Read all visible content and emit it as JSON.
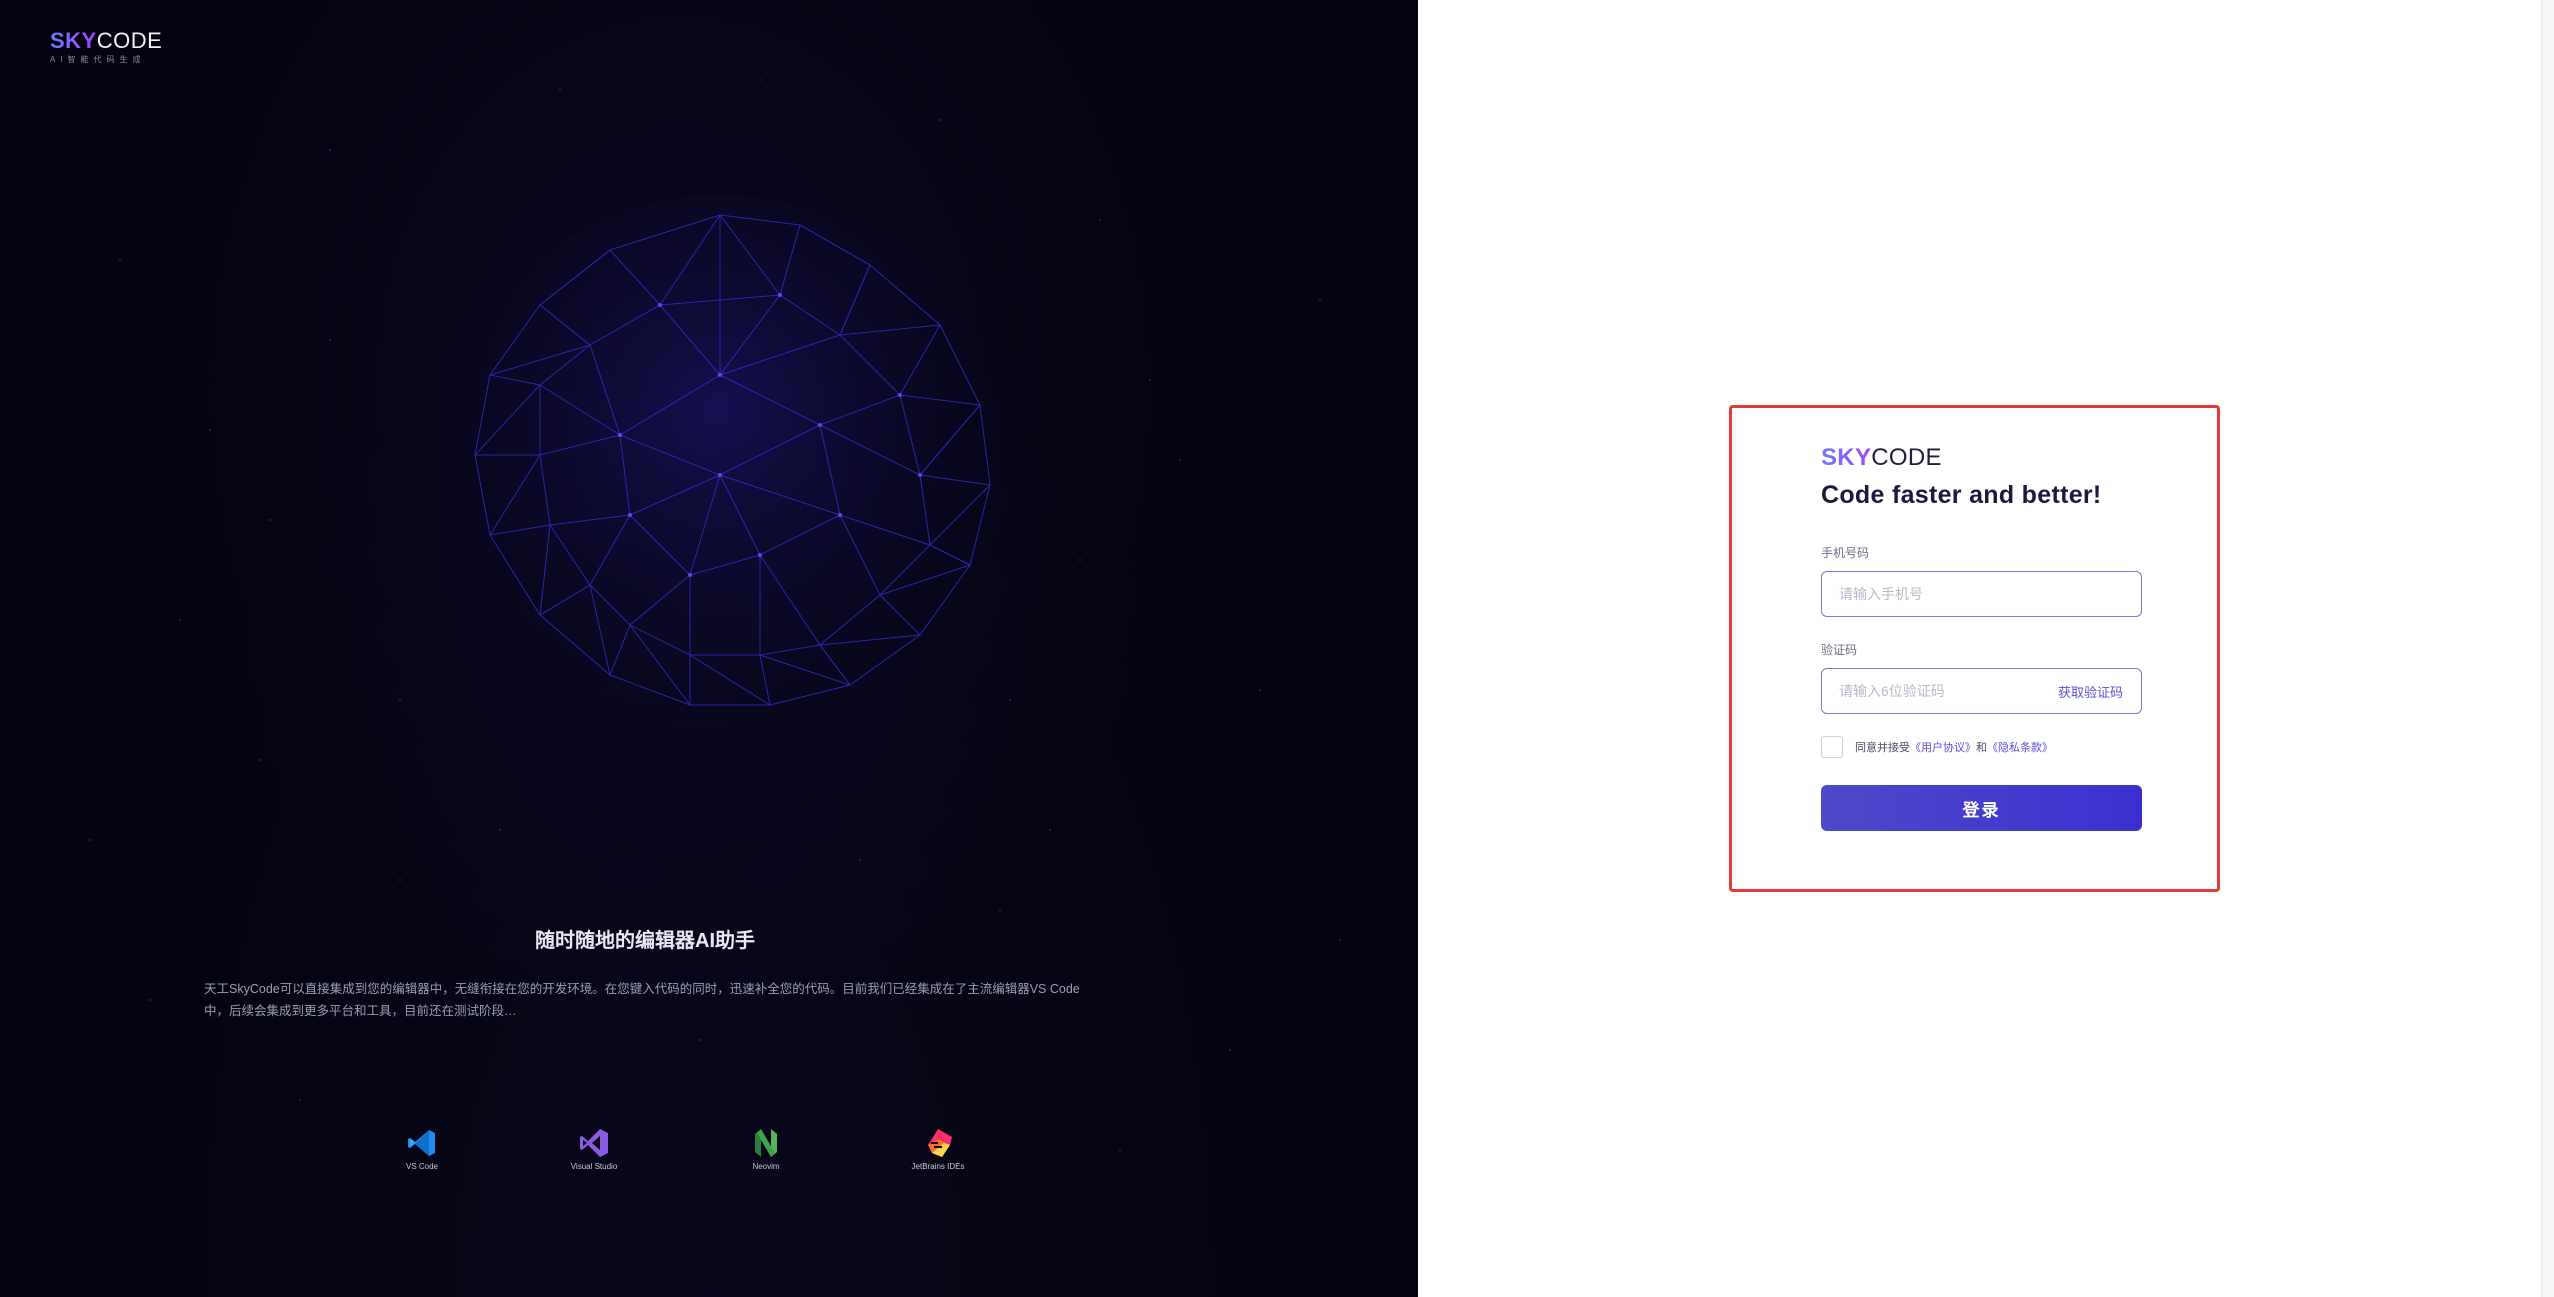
{
  "brand": {
    "logo_sky": "SKY",
    "logo_code": "CODE",
    "tagline": "AI智能代码生成"
  },
  "hero": {
    "title": "随时随地的编辑器AI助手",
    "description": "天工SkyCode可以直接集成到您的编辑器中，无缝衔接在您的开发环境。在您键入代码的同时，迅速补全您的代码。目前我们已经集成在了主流编辑器VS Code中，后续会集成到更多平台和工具，目前还在测试阶段…",
    "editors": [
      {
        "label": "VS Code",
        "icon": "vscode-icon",
        "color": "#1c8cf0"
      },
      {
        "label": "Visual Studio",
        "icon": "visual-studio-icon",
        "color": "#8a5be0"
      },
      {
        "label": "Neovim",
        "icon": "neovim-icon",
        "color": "#3fa34d"
      },
      {
        "label": "JetBrains IDEs",
        "icon": "jetbrains-icon",
        "color": "#ff2f6e"
      }
    ]
  },
  "login": {
    "logo_sky": "SKY",
    "logo_code": "CODE",
    "heading": "Code faster and better!",
    "phone_label": "手机号码",
    "phone_placeholder": "请输入手机号",
    "code_label": "验证码",
    "code_placeholder": "请输入6位验证码",
    "get_code": "获取验证码",
    "agree_prefix": "同意并接受",
    "agree_user": "《用户协议》",
    "agree_and": "和",
    "agree_privacy": "《隐私条款》",
    "submit": "登录"
  },
  "colors": {
    "hero_bg": "#04030f",
    "accent": "#5b4fdc",
    "highlight_border": "#e53935",
    "button": "#3b2fcf"
  }
}
